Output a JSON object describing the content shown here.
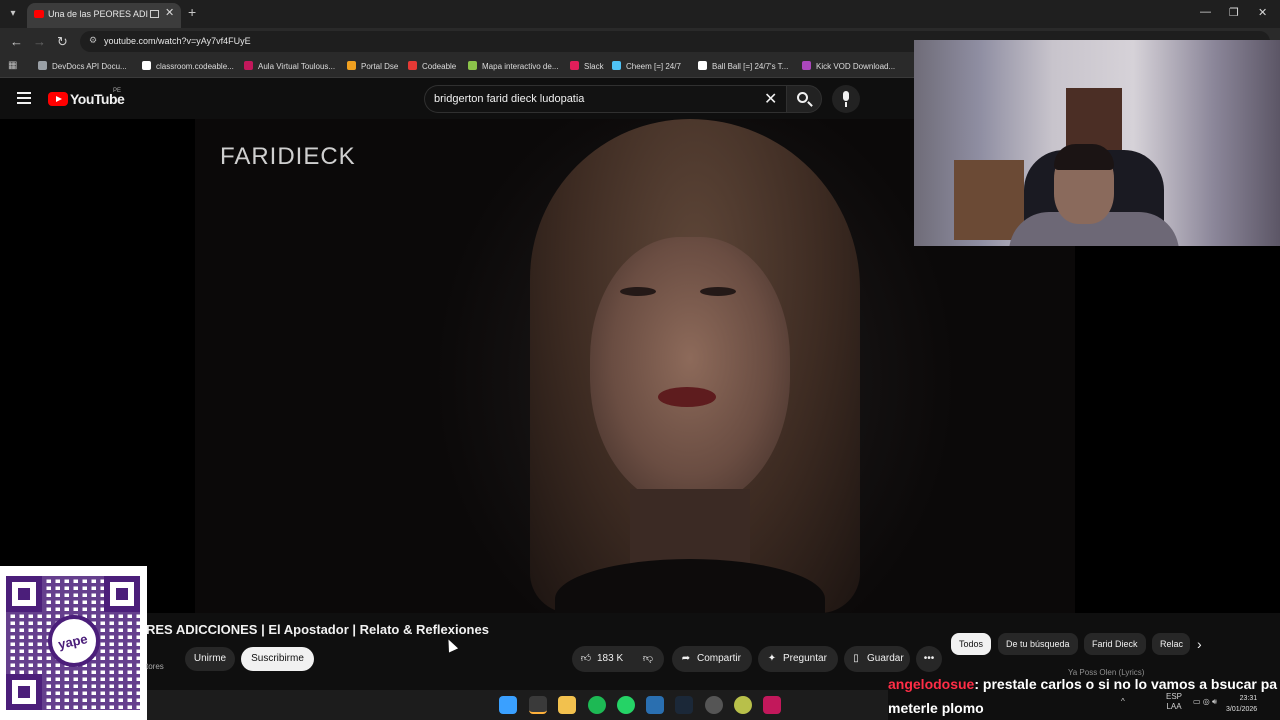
{
  "browser": {
    "tab_title": "Una de las PEORES ADICCI",
    "url": "youtube.com/watch?v=yAy7vf4FUyE",
    "bookmarks": [
      {
        "label": "DevDocs API Docu...",
        "color": "#9aa0a6"
      },
      {
        "label": "classroom.codeable...",
        "color": "#ffffff"
      },
      {
        "label": "Aula Virtual Toulous...",
        "color": "#c2185b"
      },
      {
        "label": "Portal Dse",
        "color": "#f0a020"
      },
      {
        "label": "Codeable",
        "color": "#e53935"
      },
      {
        "label": "Mapa interactivo de...",
        "color": "#8bc34a"
      },
      {
        "label": "Slack",
        "color": "#e01e5a"
      },
      {
        "label": "Cheem [=] 24/7",
        "color": "#4fc3f7"
      },
      {
        "label": "Ball Ball [=] 24/7's T...",
        "color": "#ffffff"
      },
      {
        "label": "Kick VOD Download...",
        "color": "#ab47bc"
      }
    ]
  },
  "youtube": {
    "logo_text": "YouTube",
    "region": "PE",
    "search_query": "bridgerton farid dieck ludopatia",
    "video_overlay_text": "FARIDIECK",
    "video_title": "RES ADICCIONES | El Apostador | Relato & Reflexiones",
    "subs_fragment": "tores",
    "join_label": "Unirme",
    "subscribe_label": "Suscribirme",
    "likes": "183 K",
    "share_label": "Compartir",
    "ask_label": "Preguntar",
    "save_label": "Guardar",
    "chips": [
      "Todos",
      "De tu búsqueda",
      "Farid Dieck",
      "Relac"
    ],
    "now_playing": "Ya Poss Olen (Lyrics)"
  },
  "chat": {
    "username": "angelodosue",
    "message": ": prestale carlos o si no lo vamos a bsucar pa meterle plomo"
  },
  "qr": {
    "badge_text": "yape"
  },
  "taskbar": {
    "lang_top": "ESP",
    "lang_bottom": "LAA",
    "time": "23:31",
    "date": "3/01/2026"
  }
}
